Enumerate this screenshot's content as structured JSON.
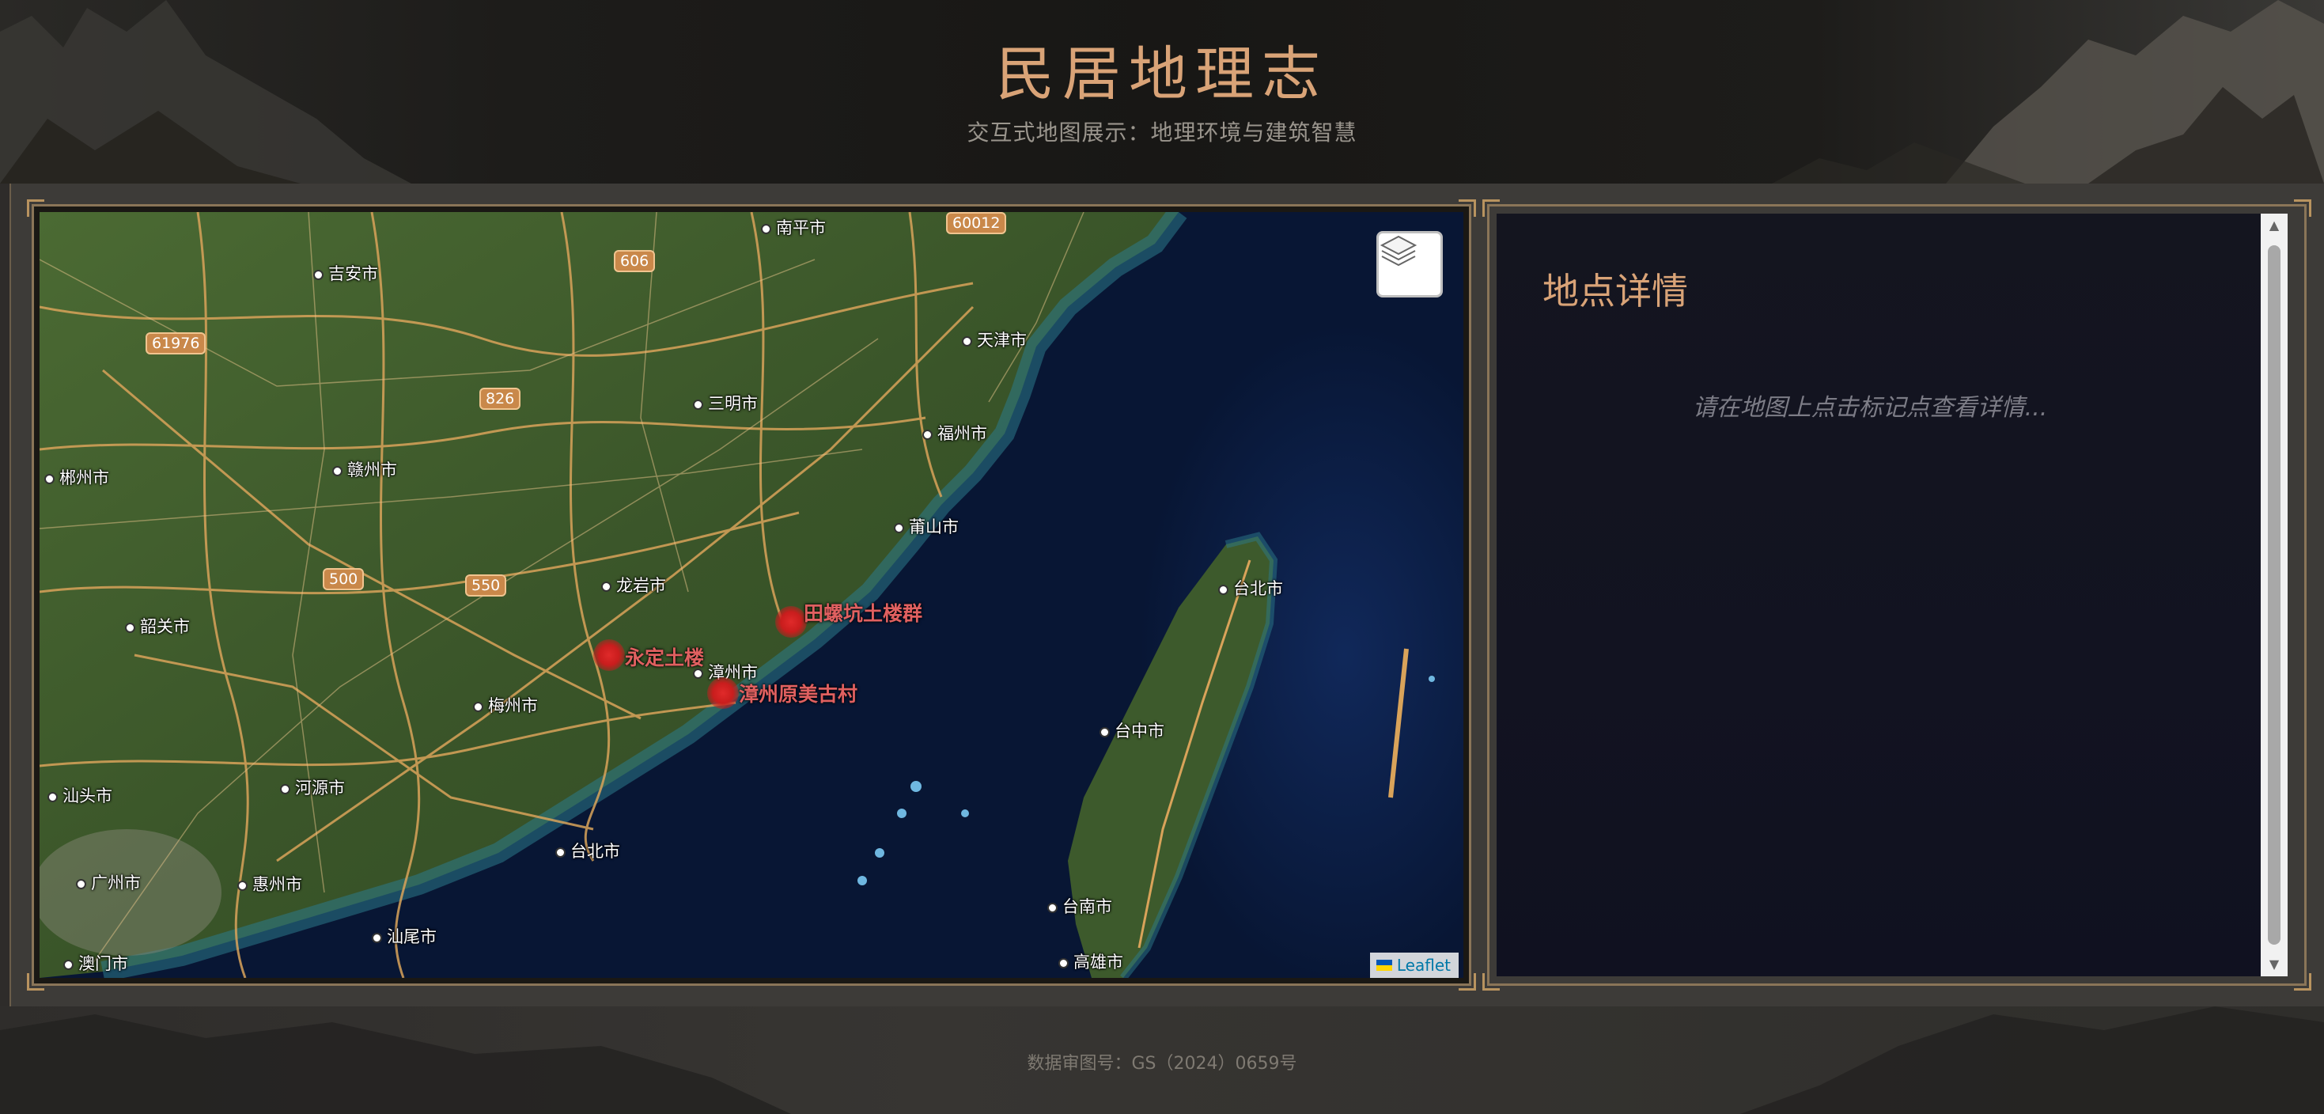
{
  "header": {
    "title": "民居地理志",
    "subtitle": "交互式地图展示：地理环境与建筑智慧"
  },
  "map": {
    "city_labels": [
      "南平市",
      "吉安市",
      "天津市",
      "三明市",
      "福州市",
      "郴州市",
      "赣州市",
      "莆山市",
      "龙岩市",
      "韶关市",
      "漳州市",
      "梅州市",
      "汕头市",
      "河源市",
      "台北市",
      "广州市",
      "惠州市",
      "汕尾市",
      "澳门市",
      "台北市",
      "台中市",
      "台南市",
      "高雄市"
    ],
    "road_shields": [
      "60012",
      "606",
      "61976",
      "826",
      "500",
      "550"
    ],
    "markers": [
      {
        "name": "田螺坑土楼群"
      },
      {
        "name": "永定土楼"
      },
      {
        "name": "漳州原美古村"
      }
    ],
    "layers_control": "layers-icon",
    "attribution": "Leaflet"
  },
  "detail_panel": {
    "title": "地点详情",
    "hint": "请在地图上点击标记点查看详情..."
  },
  "footer": {
    "text": "数据审图号：GS（2024）0659号"
  },
  "colors": {
    "accent": "#d9a377",
    "marker": "#c91d1d",
    "sea": "#081634",
    "land": "#3f5a2a",
    "frame": "#8a7558"
  }
}
